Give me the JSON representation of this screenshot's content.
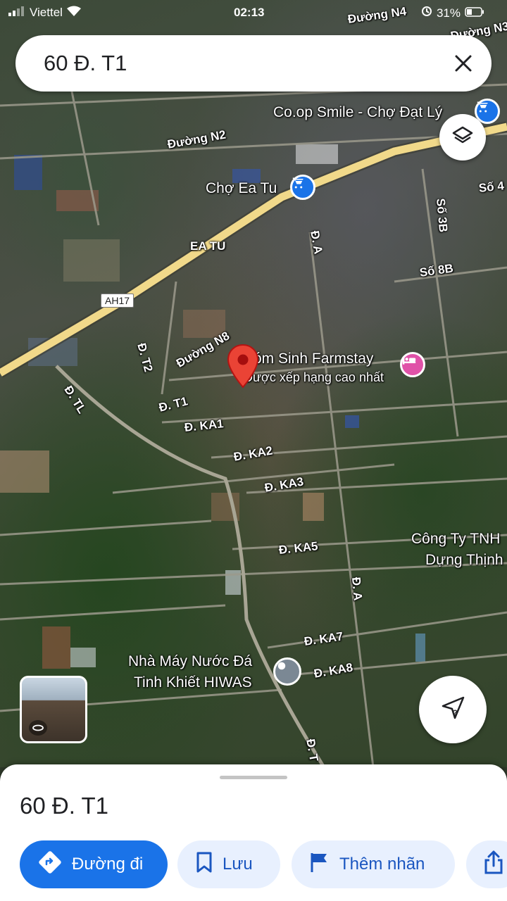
{
  "status_bar": {
    "carrier": "Viettel",
    "time": "02:13",
    "battery": "31%"
  },
  "search": {
    "query": "60 Đ. T1"
  },
  "map": {
    "road_labels": [
      "Đường N4",
      "Đường N3",
      "Đường N2",
      "EA TU",
      "AH17",
      "Đ. T2",
      "Đường N8",
      "Đ. TL",
      "Đ. T1",
      "Đ. KA1",
      "Đ. KA2",
      "Đ. KA3",
      "Đ. KA5",
      "Đ. A",
      "Đ. A",
      "Số 3B",
      "Số 4",
      "Số 8B",
      "Đ. KA7",
      "Đ. KA8",
      "Đ. T"
    ],
    "pois": {
      "coop": "Co.op Smile - Chợ Đạt Lý",
      "market": "Chợ Ea Tu",
      "farmstay": "Xóm Sinh Farmstay",
      "farmstay_sub": "Được xếp hạng cao nhất",
      "company_line1": "Công Ty TNH",
      "company_line2": "Dựng Thịnh",
      "factory_line1": "Nhà Máy Nước Đá",
      "factory_line2": "Tinh Khiết HIWAS"
    },
    "colors": {
      "pin": "#ea4335",
      "shopping": "#1a73e8",
      "hotel": "#e052a8",
      "road_highway": "#f1d98a"
    }
  },
  "sheet": {
    "title": "60 Đ. T1",
    "buttons": {
      "directions": "Đường đi",
      "save": "Lưu",
      "label": "Thêm nhãn"
    }
  }
}
